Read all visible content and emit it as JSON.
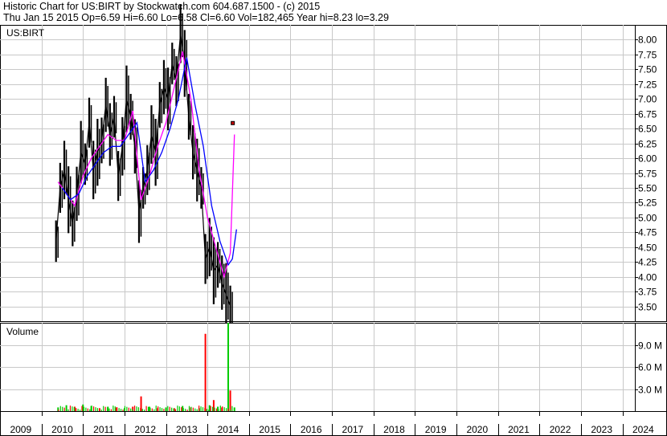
{
  "header": {
    "line1": "Historic Chart for US:BIRT by Stockwatch.com 604.687.1500 - (c) 2015",
    "line2": "Thu Jan 15 2015  Op=6.59  Hi=6.60  Lo=6.58  Cl=6.60  Vol=182,465  Year hi=8.23  lo=3.29"
  },
  "chart_data": [
    {
      "type": "line",
      "panel": "price",
      "title": "US:BIRT",
      "ylabel": "",
      "xlabel": "",
      "yticks": [
        "8.00",
        "7.75",
        "7.50",
        "7.25",
        "7.00",
        "6.75",
        "6.50",
        "6.25",
        "6.00",
        "5.75",
        "5.50",
        "5.25",
        "5.00",
        "4.75",
        "4.50",
        "4.25",
        "4.00",
        "3.75",
        "3.50"
      ],
      "ylim": [
        3.25,
        8.25
      ],
      "xlim": [
        2009.0,
        2024.3
      ],
      "grid": true,
      "colors": {
        "price": "#000000",
        "ma_short": "#ff00ff",
        "ma_long": "#0000ff",
        "last_trade": "#cc0000"
      },
      "series": [
        {
          "x": [
            2010.35,
            2010.45,
            2010.55,
            2010.65,
            2010.75,
            2010.85,
            2010.95,
            2011.05,
            2011.15,
            2011.25,
            2011.35,
            2011.45,
            2011.55,
            2011.65,
            2011.75,
            2011.85,
            2011.95,
            2012.05,
            2012.15,
            2012.25,
            2012.35,
            2012.45,
            2012.55,
            2012.65,
            2012.75,
            2012.85,
            2012.95,
            2013.05,
            2013.15,
            2013.25,
            2013.35,
            2013.45,
            2013.55,
            2013.65,
            2013.75,
            2013.85,
            2013.95,
            2014.05,
            2014.15,
            2014.25,
            2014.35,
            2014.45,
            2014.55
          ],
          "values": [
            4.6,
            5.5,
            5.8,
            5.3,
            4.9,
            5.4,
            6.1,
            5.9,
            6.6,
            5.8,
            6.1,
            6.3,
            6.9,
            6.4,
            6.7,
            5.7,
            6.2,
            7.0,
            6.7,
            6.2,
            5.1,
            5.5,
            5.8,
            6.4,
            6.1,
            6.9,
            7.2,
            7.0,
            7.6,
            7.3,
            8.1,
            7.6,
            6.7,
            6.1,
            5.8,
            5.5,
            4.3,
            4.5,
            4.1,
            4.2,
            3.9,
            3.7,
            3.5
          ]
        },
        {
          "x": [
            2010.4,
            2010.6,
            2010.8,
            2011.0,
            2011.2,
            2011.4,
            2011.6,
            2011.8,
            2012.0,
            2012.2,
            2012.4,
            2012.6,
            2012.8,
            2013.0,
            2013.2,
            2013.4,
            2013.6,
            2013.8,
            2014.0,
            2014.2,
            2014.4,
            2014.55,
            2014.65
          ],
          "values": [
            5.6,
            5.4,
            5.2,
            5.7,
            6.0,
            6.2,
            6.4,
            6.3,
            6.3,
            6.8,
            5.3,
            5.7,
            6.2,
            6.6,
            7.2,
            7.8,
            7.0,
            5.8,
            5.0,
            4.5,
            4.0,
            4.4,
            6.4
          ]
        },
        {
          "x": [
            2010.5,
            2010.7,
            2010.9,
            2011.1,
            2011.3,
            2011.5,
            2011.7,
            2011.9,
            2012.1,
            2012.3,
            2012.5,
            2012.7,
            2012.9,
            2013.1,
            2013.3,
            2013.5,
            2013.7,
            2013.9,
            2014.1,
            2014.3,
            2014.5,
            2014.6,
            2014.7
          ],
          "values": [
            5.5,
            5.3,
            5.4,
            5.7,
            5.9,
            6.1,
            6.2,
            6.2,
            6.4,
            6.6,
            5.6,
            5.8,
            6.1,
            6.5,
            7.0,
            7.7,
            6.9,
            6.2,
            5.2,
            4.6,
            4.2,
            4.3,
            4.8
          ]
        },
        {
          "x": [
            2014.6
          ],
          "values": [
            6.6
          ]
        }
      ]
    },
    {
      "type": "bar",
      "panel": "volume",
      "title": "Volume",
      "yticks": [
        "9.0 M",
        "6.0 M",
        "3.0 M"
      ],
      "ylim": [
        0,
        12
      ],
      "xlim": [
        2009.0,
        2024.3
      ],
      "grid": true,
      "colors": {
        "up": "#00cc00",
        "down": "#ff0000"
      },
      "bars": [
        {
          "x": 2010.4,
          "value": 0.5,
          "color": "green"
        },
        {
          "x": 2010.6,
          "value": 0.8,
          "color": "green"
        },
        {
          "x": 2010.8,
          "value": 0.6,
          "color": "red"
        },
        {
          "x": 2011.0,
          "value": 0.9,
          "color": "green"
        },
        {
          "x": 2011.2,
          "value": 0.7,
          "color": "green"
        },
        {
          "x": 2011.4,
          "value": 0.4,
          "color": "red"
        },
        {
          "x": 2011.6,
          "value": 0.6,
          "color": "green"
        },
        {
          "x": 2011.8,
          "value": 0.5,
          "color": "red"
        },
        {
          "x": 2012.0,
          "value": 0.4,
          "color": "green"
        },
        {
          "x": 2012.2,
          "value": 0.6,
          "color": "red"
        },
        {
          "x": 2012.4,
          "value": 2.0,
          "color": "red"
        },
        {
          "x": 2012.6,
          "value": 0.6,
          "color": "green"
        },
        {
          "x": 2012.8,
          "value": 0.4,
          "color": "red"
        },
        {
          "x": 2013.0,
          "value": 0.5,
          "color": "green"
        },
        {
          "x": 2013.2,
          "value": 0.4,
          "color": "red"
        },
        {
          "x": 2013.4,
          "value": 0.7,
          "color": "green"
        },
        {
          "x": 2013.6,
          "value": 0.5,
          "color": "red"
        },
        {
          "x": 2013.8,
          "value": 0.4,
          "color": "green"
        },
        {
          "x": 2013.95,
          "value": 10.5,
          "color": "red"
        },
        {
          "x": 2014.05,
          "value": 0.8,
          "color": "green"
        },
        {
          "x": 2014.15,
          "value": 1.5,
          "color": "red"
        },
        {
          "x": 2014.25,
          "value": 0.6,
          "color": "green"
        },
        {
          "x": 2014.35,
          "value": 0.5,
          "color": "red"
        },
        {
          "x": 2014.5,
          "value": 12.0,
          "color": "green"
        },
        {
          "x": 2014.55,
          "value": 2.8,
          "color": "red"
        },
        {
          "x": 2014.65,
          "value": 0.5,
          "color": "green"
        }
      ]
    },
    {
      "type": "axis",
      "panel": "years",
      "labels": [
        "2009",
        "2010",
        "2011",
        "2012",
        "2013",
        "2014",
        "2015",
        "2016",
        "2017",
        "2018",
        "2019",
        "2020",
        "2021",
        "2022",
        "2023",
        "2024"
      ],
      "values": [
        2009,
        2010,
        2011,
        2012,
        2013,
        2014,
        2015,
        2016,
        2017,
        2018,
        2019,
        2020,
        2021,
        2022,
        2023,
        2024
      ]
    }
  ]
}
